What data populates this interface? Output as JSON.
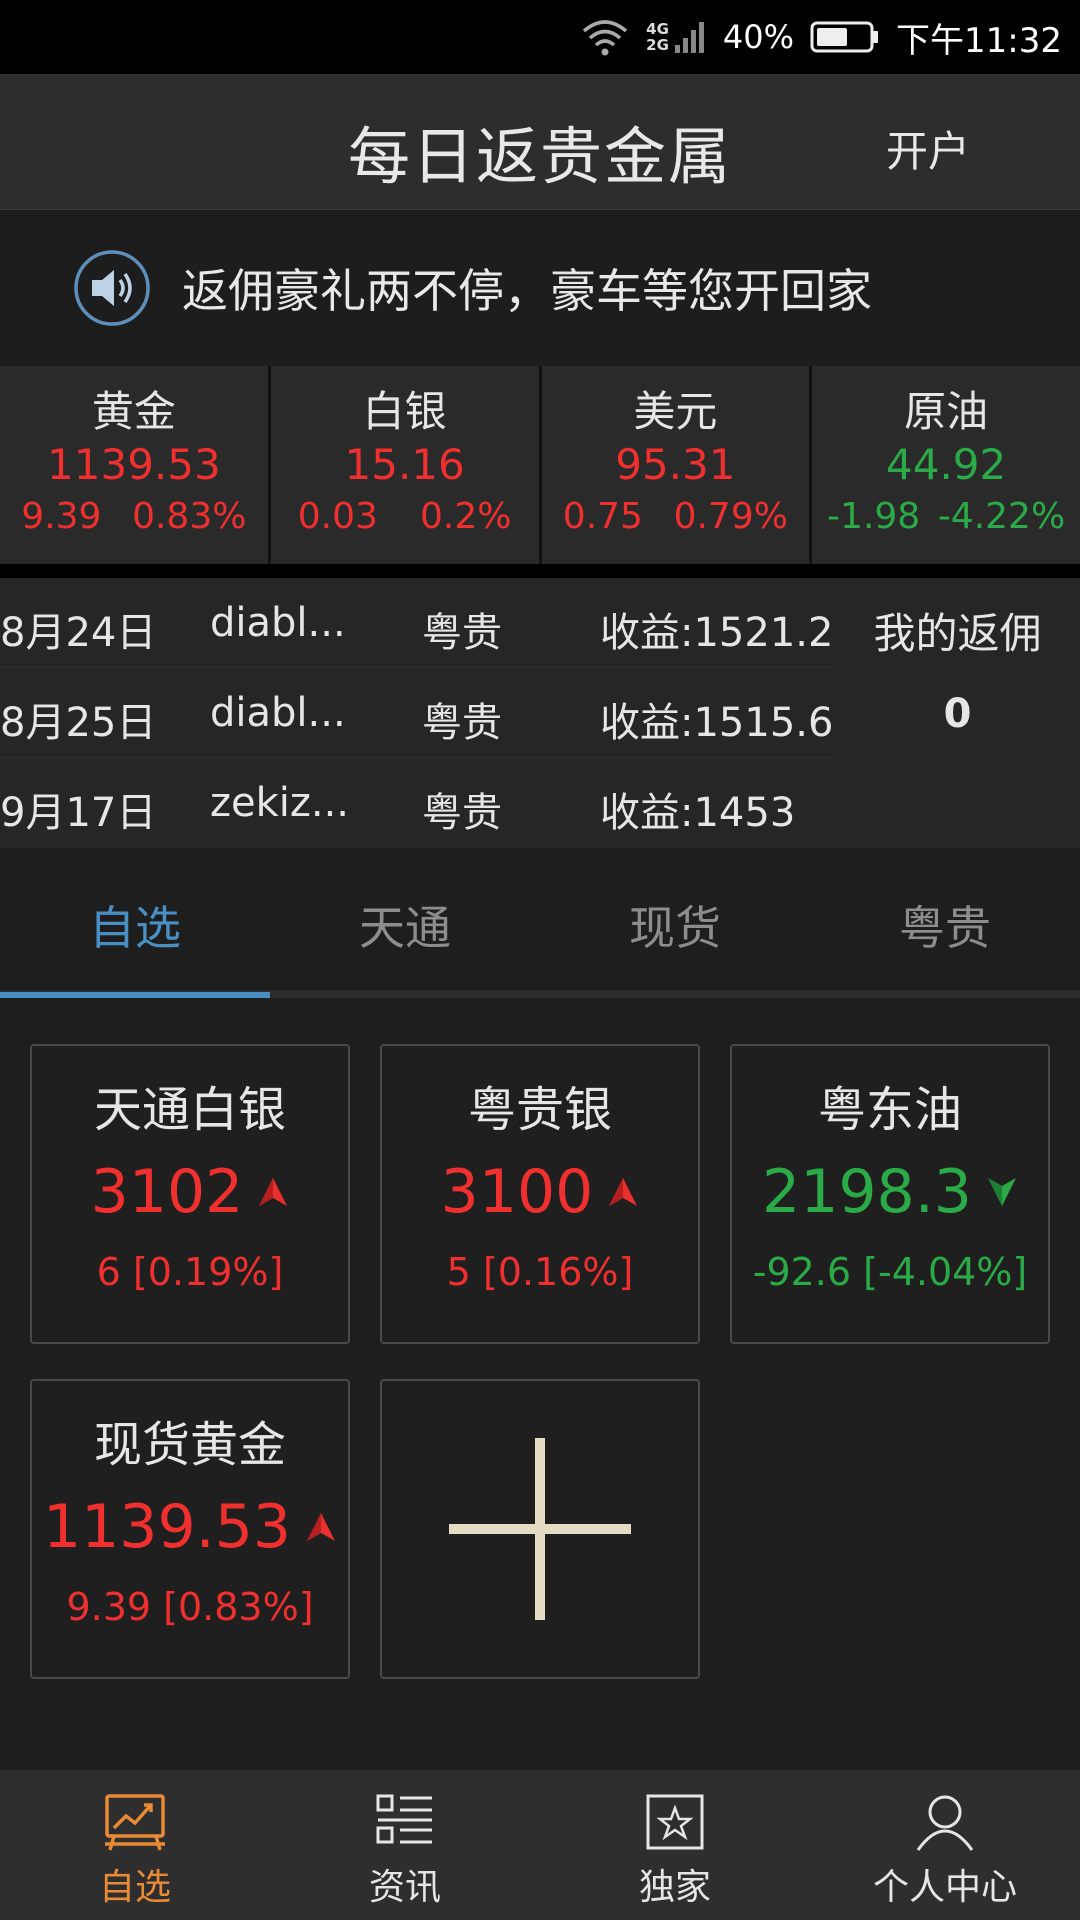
{
  "status_bar": {
    "network_top": "4G",
    "network_bottom": "2G",
    "battery_percent": "40%",
    "time": "下午11:32"
  },
  "header": {
    "title": "每日返贵金属",
    "open_account": "开户"
  },
  "notice": {
    "text": "返佣豪礼两不停，豪车等您开回家",
    "icon": "speaker-icon"
  },
  "quotes": [
    {
      "name": "黄金",
      "price": "1139.53",
      "change": "9.39",
      "percent": "0.83%",
      "trend": "up"
    },
    {
      "name": "白银",
      "price": "15.16",
      "change": "0.03",
      "percent": "0.2%",
      "trend": "up"
    },
    {
      "name": "美元",
      "price": "95.31",
      "change": "0.75",
      "percent": "0.79%",
      "trend": "up"
    },
    {
      "name": "原油",
      "price": "44.92",
      "change": "-1.98",
      "percent": "-4.22%",
      "trend": "down"
    }
  ],
  "rebate": {
    "rows": [
      {
        "date": "8月24日",
        "user": "diabl...",
        "company": "粤贵",
        "amount": "收益:1521.2"
      },
      {
        "date": "8月25日",
        "user": "diabl...",
        "company": "粤贵",
        "amount": "收益:1515.6"
      },
      {
        "date": "9月17日",
        "user": "zekiz...",
        "company": "粤贵",
        "amount": "收益:1453"
      }
    ],
    "my_rebate_label": "我的返佣",
    "my_rebate_value": "0"
  },
  "tabs": [
    {
      "label": "自选",
      "active": true
    },
    {
      "label": "天通",
      "active": false
    },
    {
      "label": "现货",
      "active": false
    },
    {
      "label": "粤贵",
      "active": false
    }
  ],
  "cards": [
    {
      "name": "天通白银",
      "price": "3102",
      "change": "6",
      "percent": "[0.19%]",
      "trend": "up"
    },
    {
      "name": "粤贵银",
      "price": "3100",
      "change": "5",
      "percent": "[0.16%]",
      "trend": "up"
    },
    {
      "name": "粤东油",
      "price": "2198.3",
      "change": "-92.6",
      "percent": "[-4.04%]",
      "trend": "down"
    },
    {
      "name": "现货黄金",
      "price": "1139.53",
      "change": "9.39",
      "percent": "[0.83%]",
      "trend": "up"
    }
  ],
  "bottom_nav": [
    {
      "label": "自选",
      "icon": "chart-board-icon",
      "active": true
    },
    {
      "label": "资讯",
      "icon": "list-icon",
      "active": false
    },
    {
      "label": "独家",
      "icon": "star-frame-icon",
      "active": false
    },
    {
      "label": "个人中心",
      "icon": "person-icon",
      "active": false
    }
  ],
  "colors": {
    "up": "#f0302f",
    "down": "#2aab47",
    "accent": "#4a8fc4",
    "nav_active": "#e98a35"
  }
}
